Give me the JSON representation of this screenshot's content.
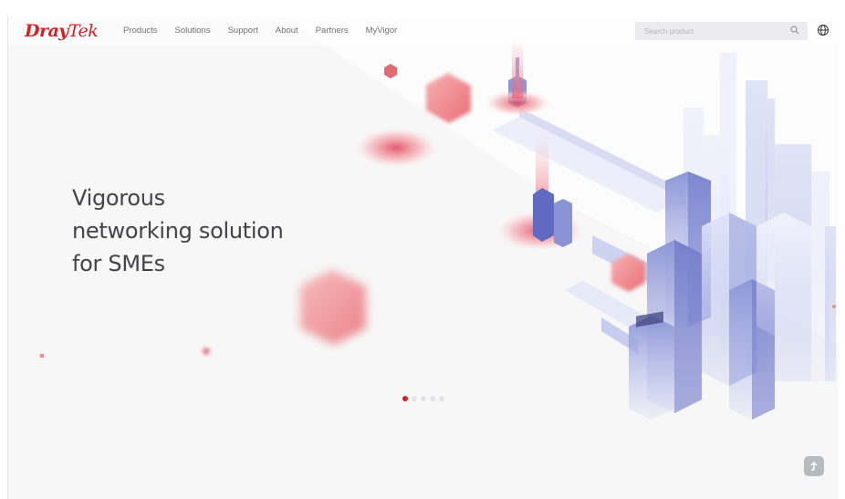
{
  "header": {
    "logo_dray": "Dray",
    "logo_tek": "Tek",
    "nav": [
      "Products",
      "Solutions",
      "Support",
      "About",
      "Partners",
      "MyVigor"
    ],
    "search_placeholder": "Search product"
  },
  "hero": {
    "line1": "Vigorous",
    "line2": "networking solution",
    "line3": "for SMEs"
  },
  "carousel": {
    "slides": 5,
    "active_index": 0
  },
  "colors": {
    "brand": "#d61f26",
    "text": "#444446",
    "nav": "#707070"
  },
  "icons": [
    "search-icon",
    "globe-icon",
    "arrow-up-icon"
  ]
}
